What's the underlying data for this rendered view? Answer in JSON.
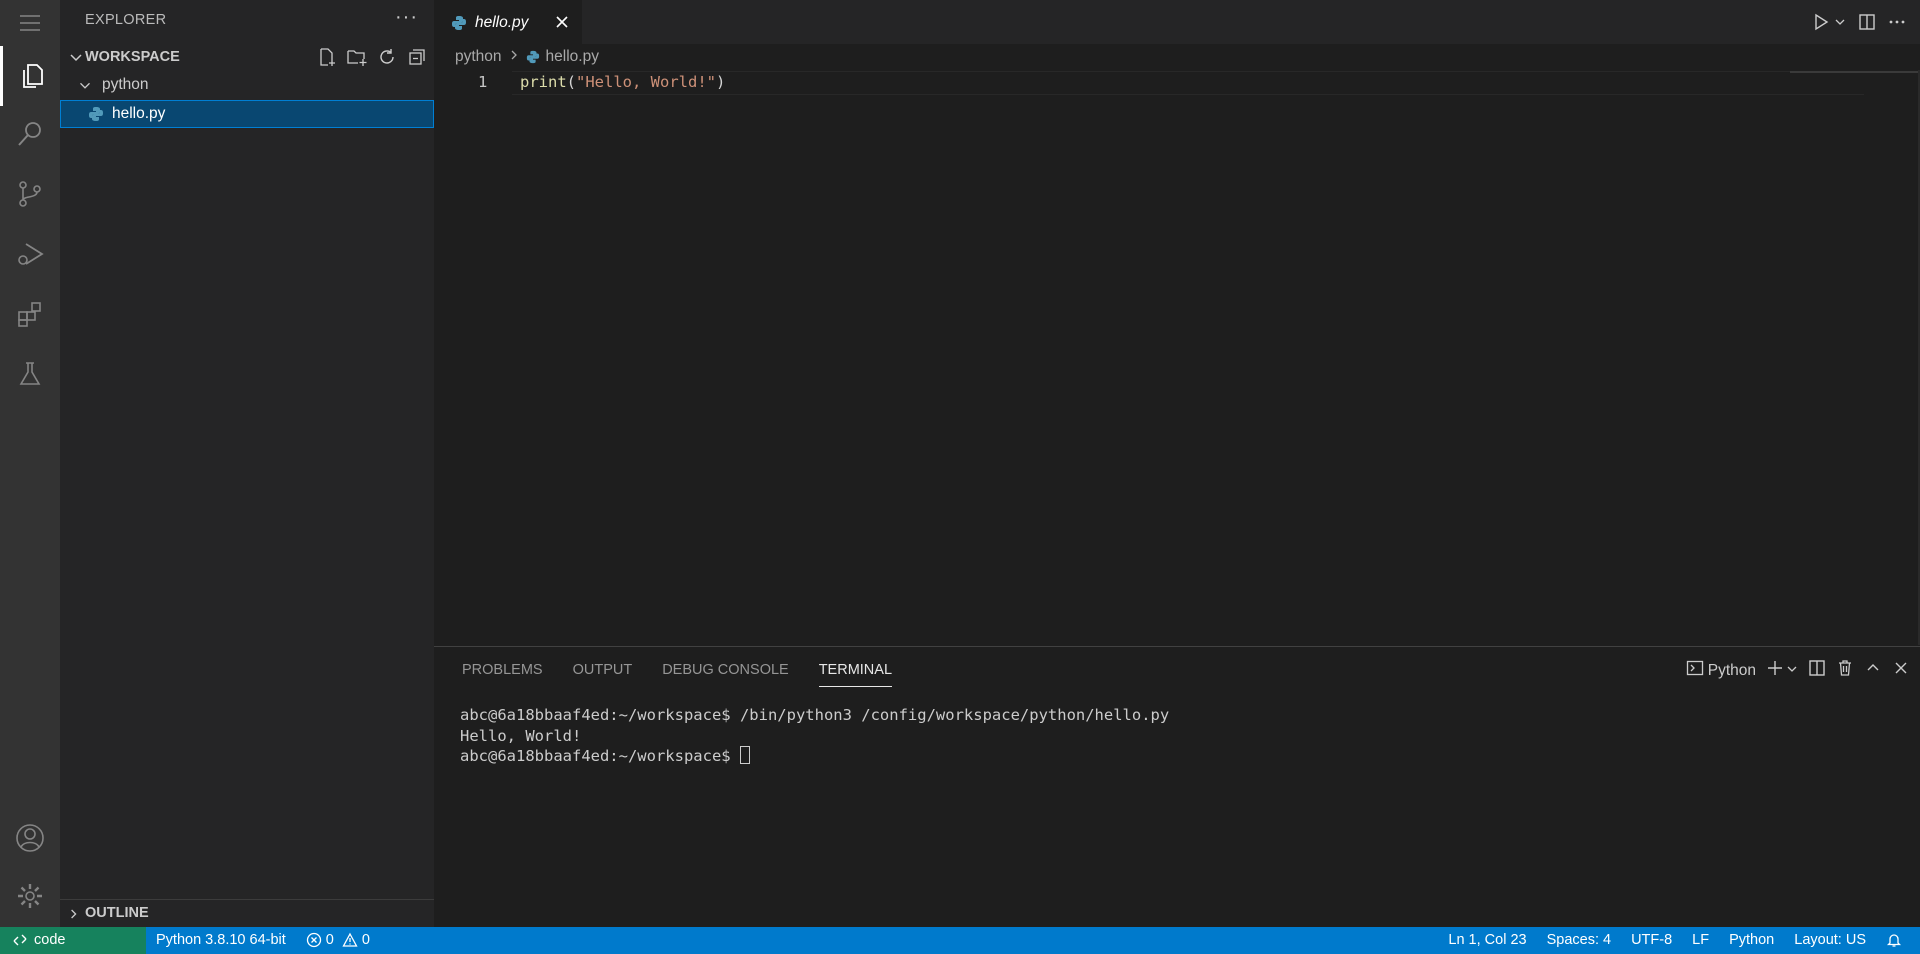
{
  "colors": {
    "activity_bar": "#333333",
    "sidebar": "#252526",
    "editor": "#1e1e1e",
    "selection": "#094771",
    "status_bar": "#007acc",
    "remote_indicator": "#16825d"
  },
  "activity_bar": {
    "items": [
      "menu-icon",
      "files-icon",
      "search-icon",
      "source-control-icon",
      "run-debug-icon",
      "extensions-icon",
      "testing-icon"
    ],
    "bottom": [
      "account-icon",
      "gear-icon"
    ]
  },
  "sidebar": {
    "title": "EXPLORER",
    "more": "···",
    "workspace_label": "WORKSPACE",
    "folder": "python",
    "file": "hello.py",
    "outline_label": "OUTLINE"
  },
  "editor": {
    "tab_label": "hello.py",
    "breadcrumb": {
      "folder": "python",
      "file": "hello.py"
    },
    "line_number": "1",
    "code": {
      "fn": "print",
      "open": "(",
      "str": "\"Hello, World!\"",
      "close": ")"
    }
  },
  "panel": {
    "tabs": [
      "PROBLEMS",
      "OUTPUT",
      "DEBUG CONSOLE",
      "TERMINAL"
    ],
    "active_tab": "TERMINAL",
    "terminal_name": "Python",
    "terminal_lines": [
      "abc@6a18bbaaf4ed:~/workspace$ /bin/python3 /config/workspace/python/hello.py",
      "Hello, World!",
      "abc@6a18bbaaf4ed:~/workspace$ "
    ]
  },
  "status_bar": {
    "remote": "code",
    "interpreter": "Python 3.8.10 64-bit",
    "errors": "0",
    "warnings": "0",
    "position": "Ln 1, Col 23",
    "spaces": "Spaces: 4",
    "encoding": "UTF-8",
    "eol": "LF",
    "language": "Python",
    "layout": "Layout: US"
  }
}
